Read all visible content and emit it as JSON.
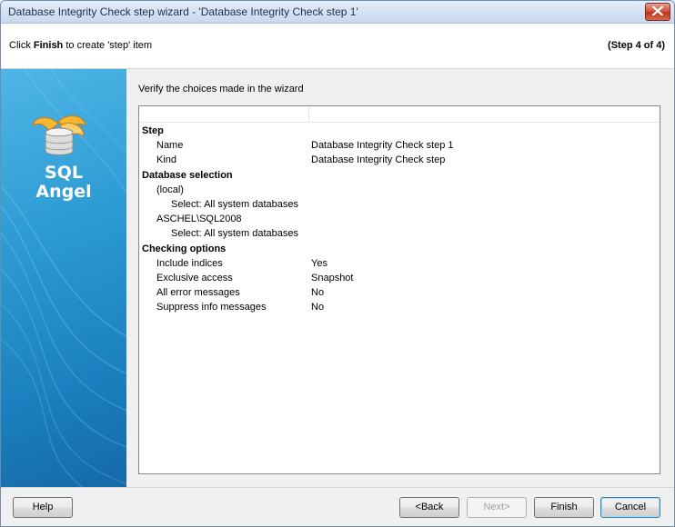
{
  "window": {
    "title": "Database Integrity Check step wizard - 'Database Integrity Check step 1'"
  },
  "header": {
    "text_prefix": "Click ",
    "text_bold": "Finish",
    "text_suffix": " to create 'step' item",
    "step_indicator": "(Step 4 of 4)"
  },
  "banner": {
    "logo_line1": "SQL",
    "logo_line2": "Angel"
  },
  "main": {
    "instruction": "Verify the choices made in the wizard",
    "rows": [
      {
        "type": "category",
        "name": "Step"
      },
      {
        "type": "prop",
        "indent": 1,
        "name": "Name",
        "value": "Database Integrity Check step 1"
      },
      {
        "type": "prop",
        "indent": 1,
        "name": "Kind",
        "value": "Database Integrity Check step"
      },
      {
        "type": "category",
        "name": "Database selection"
      },
      {
        "type": "prop",
        "indent": 1,
        "name": "(local)",
        "value": ""
      },
      {
        "type": "prop",
        "indent": 2,
        "name": "Select: All system databases",
        "value": ""
      },
      {
        "type": "prop",
        "indent": 1,
        "name": "ASCHEL\\SQL2008",
        "value": ""
      },
      {
        "type": "prop",
        "indent": 2,
        "name": "Select: All system databases",
        "value": ""
      },
      {
        "type": "category",
        "name": "Checking options"
      },
      {
        "type": "prop",
        "indent": 1,
        "name": "Include indices",
        "value": "Yes"
      },
      {
        "type": "prop",
        "indent": 1,
        "name": "Exclusive access",
        "value": "Snapshot"
      },
      {
        "type": "prop",
        "indent": 1,
        "name": "All error messages",
        "value": "No"
      },
      {
        "type": "prop",
        "indent": 1,
        "name": "Suppress info messages",
        "value": "No"
      }
    ]
  },
  "footer": {
    "help_label": "Help",
    "back_label": "<Back",
    "next_label": "Next>",
    "finish_label": "Finish",
    "cancel_label": "Cancel"
  },
  "icons": {
    "close": "close-icon",
    "logo": "sql-angel-logo-icon"
  },
  "colors": {
    "banner_blue": "#2b9ad3",
    "close_red": "#c2351b",
    "title_gradient": "#d5e2f2"
  }
}
